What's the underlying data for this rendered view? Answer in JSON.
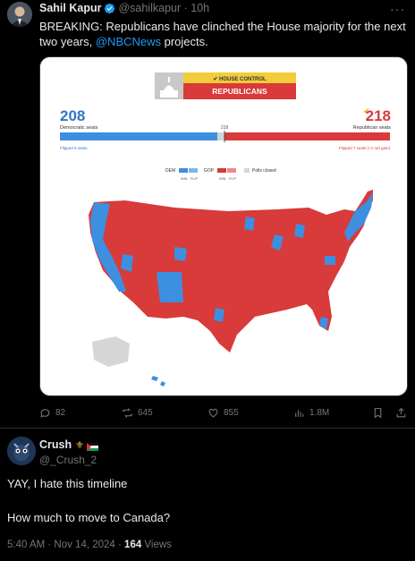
{
  "post": {
    "author_name": "Sahil Kapur",
    "author_handle": "@sahilkapur",
    "time_ago": "10h",
    "text_prefix": "BREAKING: Republicans have clinched the House majority for the next two years, ",
    "mention": "@NBCNews",
    "text_suffix": " projects.",
    "more_label": "···"
  },
  "graphic": {
    "banner_top": "HOUSE CONTROL",
    "banner_main": "REPUBLICANS",
    "dem_seats": "208",
    "dem_label": "Democratic seats",
    "rep_seats": "218",
    "rep_label": "Republican seats",
    "majority_mark": "218",
    "dem_flipped": "Flipped 6 seats",
    "rep_flipped": "Flipped 7 seats (+1 net gain)",
    "legend_dem": "DEM",
    "legend_gop": "GOP",
    "legend_win": "WIN",
    "legend_flip": "FLIP",
    "legend_closed": "Polls closed",
    "dem_color": "#3d8fe0",
    "rep_color": "#d93a3a"
  },
  "stats": {
    "replies": "82",
    "reposts": "645",
    "likes": "855",
    "views": "1.8M"
  },
  "reply": {
    "author_name": "Crush",
    "author_handle": "@_Crush_2",
    "line1": "YAY, I hate this timeline",
    "line2": "How much to move to Canada?",
    "timestamp": "5:40 AM · Nov 14, 2024 · ",
    "views_count": "164",
    "views_label": " Views"
  }
}
